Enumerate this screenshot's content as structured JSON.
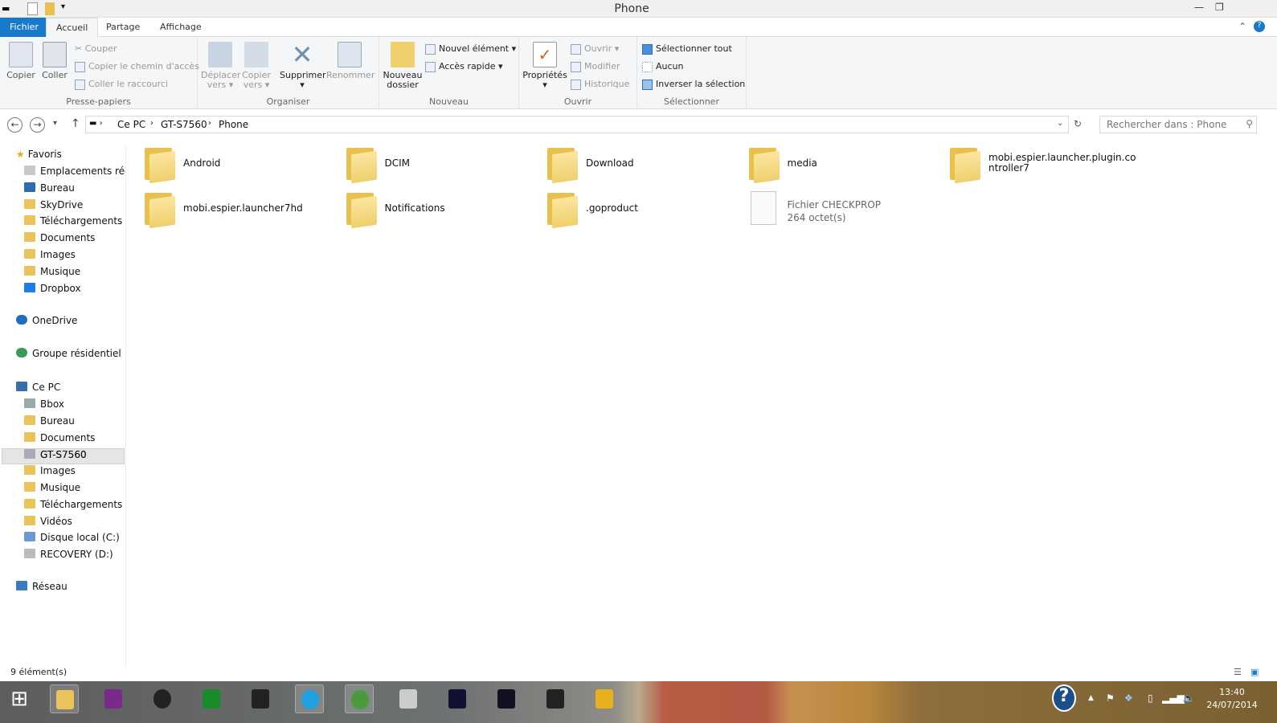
{
  "window": {
    "title": "Phone"
  },
  "tabs": {
    "file": "Fichier",
    "home": "Accueil",
    "share": "Partage",
    "view": "Affichage"
  },
  "ribbon": {
    "clipboard": {
      "label": "Presse-papiers",
      "copy": "Copier",
      "paste": "Coller",
      "cut": "Couper",
      "copy_path": "Copier le chemin d'accès",
      "paste_shortcut": "Coller le raccourci"
    },
    "organize": {
      "label": "Organiser",
      "move": "Déplacer",
      "move2": "vers",
      "copy_to": "Copier",
      "copy_to2": "vers",
      "delete": "Supprimer",
      "rename": "Renommer"
    },
    "new": {
      "label": "Nouveau",
      "new_folder": "Nouveau",
      "new_folder2": "dossier",
      "new_item": "Nouvel élément",
      "easy_access": "Accès rapide"
    },
    "open": {
      "label": "Ouvrir",
      "properties": "Propriétés",
      "open": "Ouvrir",
      "edit": "Modifier",
      "history": "Historique"
    },
    "select": {
      "label": "Sélectionner",
      "all": "Sélectionner tout",
      "none": "Aucun",
      "invert": "Inverser la sélection"
    }
  },
  "address": {
    "crumbs": [
      "Ce PC",
      "GT-S7560",
      "Phone"
    ],
    "search_placeholder": "Rechercher dans : Phone"
  },
  "nav": {
    "favorites": "Favoris",
    "fav_items": [
      "Emplacements récents",
      "Bureau",
      "SkyDrive",
      "Téléchargements",
      "Documents",
      "Images",
      "Musique",
      "Dropbox"
    ],
    "onedrive": "OneDrive",
    "homegroup": "Groupe résidentiel",
    "thispc": "Ce PC",
    "pc_items": [
      "Bbox",
      "Bureau",
      "Documents",
      "GT-S7560",
      "Images",
      "Musique",
      "Téléchargements",
      "Vidéos",
      "Disque local (C:)",
      "RECOVERY (D:)"
    ],
    "network": "Réseau",
    "selected": "GT-S7560"
  },
  "files": [
    {
      "name": "Android",
      "type": "folder"
    },
    {
      "name": "DCIM",
      "type": "folder"
    },
    {
      "name": "Download",
      "type": "folder"
    },
    {
      "name": "media",
      "type": "folder"
    },
    {
      "name": "mobi.espier.launcher.plugin.controller7",
      "type": "folder"
    },
    {
      "name": "mobi.espier.launcher7hd",
      "type": "folder"
    },
    {
      "name": "Notifications",
      "type": "folder"
    },
    {
      "name": ".goproduct",
      "type": "folder"
    },
    {
      "name": "Fichier CHECKPROP",
      "type": "file",
      "size": "264 octet(s)"
    }
  ],
  "status": {
    "count": "9 élément(s)"
  },
  "taskbar": {
    "time": "13:40",
    "date": "24/07/2014",
    "apps": [
      "start",
      "file-explorer",
      "remote-app",
      "media-player",
      "store",
      "app-dark",
      "skype",
      "chrome",
      "snipping-tool",
      "game",
      "cheat-engine",
      "app-car",
      "tools"
    ]
  }
}
